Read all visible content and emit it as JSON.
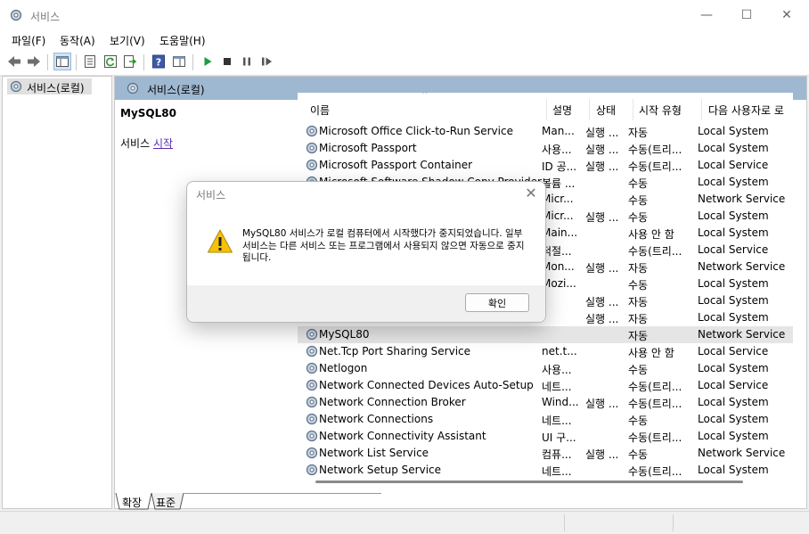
{
  "window": {
    "title": "서비스"
  },
  "menu": [
    "파일(F)",
    "동작(A)",
    "보기(V)",
    "도움말(H)"
  ],
  "tree": {
    "root_label": "서비스(로컬)"
  },
  "pane": {
    "header": "서비스(로컬)",
    "selected_service": "MySQL80",
    "action_prefix": "서비스",
    "action_link": "시작"
  },
  "list": {
    "columns": [
      "이름",
      "설명",
      "상태",
      "시작 유형",
      "다음 사용자로 로"
    ],
    "rows": [
      {
        "name": "Microsoft Office Click-to-Run Service",
        "desc": "Man...",
        "status": "실행 ...",
        "startup": "자동",
        "logon": "Local System"
      },
      {
        "name": "Microsoft Passport",
        "desc": "사용...",
        "status": "실행 ...",
        "startup": "수동(트리...",
        "logon": "Local System"
      },
      {
        "name": "Microsoft Passport Container",
        "desc": "ID 공...",
        "status": "실행 ...",
        "startup": "수동(트리...",
        "logon": "Local Service"
      },
      {
        "name": "Microsoft Software Shadow Copy Provider",
        "desc": "볼륨 ...",
        "status": "",
        "startup": "수동",
        "logon": "Local System"
      },
      {
        "name": "",
        "desc": "Micr...",
        "status": "",
        "startup": "수동",
        "logon": "Network Service"
      },
      {
        "name": "",
        "desc": "Micr...",
        "status": "실행 ...",
        "startup": "수동",
        "logon": "Local System"
      },
      {
        "name": "",
        "desc": "Main...",
        "status": "",
        "startup": "사용 안 함",
        "logon": "Local System"
      },
      {
        "name": "",
        "desc": "적절...",
        "status": "",
        "startup": "수동(트리...",
        "logon": "Local Service"
      },
      {
        "name": "",
        "desc": "Mon...",
        "status": "실행 ...",
        "startup": "자동",
        "logon": "Network Service"
      },
      {
        "name": "",
        "desc": "Mozi...",
        "status": "",
        "startup": "수동",
        "logon": "Local System"
      },
      {
        "name": "",
        "desc": "",
        "status": "실행 ...",
        "startup": "자동",
        "logon": "Local System"
      },
      {
        "name": "",
        "desc": "",
        "status": "실행 ...",
        "startup": "자동",
        "logon": "Local System"
      },
      {
        "name": "MySQL80",
        "desc": "",
        "status": "",
        "startup": "자동",
        "logon": "Network Service"
      },
      {
        "name": "Net.Tcp Port Sharing Service",
        "desc": "net.t...",
        "status": "",
        "startup": "사용 안 함",
        "logon": "Local Service"
      },
      {
        "name": "Netlogon",
        "desc": "사용...",
        "status": "",
        "startup": "수동",
        "logon": "Local System"
      },
      {
        "name": "Network Connected Devices Auto-Setup",
        "desc": "네트...",
        "status": "",
        "startup": "수동(트리...",
        "logon": "Local Service"
      },
      {
        "name": "Network Connection Broker",
        "desc": "Wind...",
        "status": "실행 ...",
        "startup": "수동(트리...",
        "logon": "Local System"
      },
      {
        "name": "Network Connections",
        "desc": "네트...",
        "status": "",
        "startup": "수동",
        "logon": "Local System"
      },
      {
        "name": "Network Connectivity Assistant",
        "desc": "UI 구...",
        "status": "",
        "startup": "수동(트리...",
        "logon": "Local System"
      },
      {
        "name": "Network List Service",
        "desc": "컴퓨...",
        "status": "실행 ...",
        "startup": "수동",
        "logon": "Network Service"
      },
      {
        "name": "Network Setup Service",
        "desc": "네트...",
        "status": "",
        "startup": "수동(트리...",
        "logon": "Local System"
      }
    ]
  },
  "tabs": [
    "확장",
    "표준"
  ],
  "dialog": {
    "title": "서비스",
    "message": "MySQL80 서비스가 로컬 컴퓨터에서 시작했다가 중지되었습니다. 일부 서비스는 다른 서비스 또는 프로그램에서 사용되지 않으면 자동으로 중지됩니다.",
    "ok_label": "확인"
  },
  "colors": {
    "header_bar": "#9fb8d1",
    "selected_row": "#e5e5e5",
    "warning": "#f4c20d"
  }
}
